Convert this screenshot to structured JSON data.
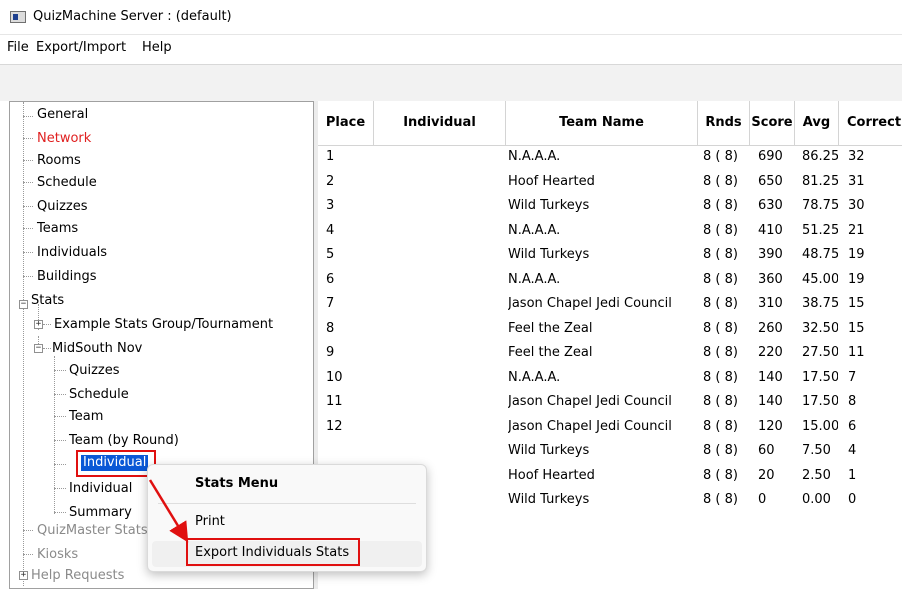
{
  "window": {
    "title": "QuizMachine Server : (default)"
  },
  "menubar": {
    "items": [
      "File",
      "Export/Import",
      "Help"
    ]
  },
  "tree": {
    "items": [
      {
        "label": "General",
        "color": "#000000"
      },
      {
        "label": "Network",
        "color": "#e02020"
      },
      {
        "label": "Rooms",
        "color": "#000000"
      },
      {
        "label": "Schedule",
        "color": "#000000"
      },
      {
        "label": "Quizzes",
        "color": "#000000"
      },
      {
        "label": "Teams",
        "color": "#000000"
      },
      {
        "label": "Individuals",
        "color": "#000000"
      },
      {
        "label": "Buildings",
        "color": "#000000"
      },
      {
        "label": "Stats",
        "color": "#000000"
      },
      {
        "label": "Example Stats Group/Tournament",
        "color": "#000000"
      },
      {
        "label": "MidSouth Nov",
        "color": "#000000"
      },
      {
        "label": "Quizzes",
        "color": "#000000"
      },
      {
        "label": "Schedule",
        "color": "#000000"
      },
      {
        "label": "Team",
        "color": "#000000"
      },
      {
        "label": "Team (by Round)",
        "color": "#000000"
      },
      {
        "label": "Individual",
        "color": "#ffffff"
      },
      {
        "label": "Individual",
        "color": "#000000"
      },
      {
        "label": "Summary",
        "color": "#000000"
      },
      {
        "label": "QuizMaster Stats",
        "color": "#8a8a8a"
      },
      {
        "label": "Kiosks",
        "color": "#8a8a8a"
      },
      {
        "label": "Help Requests",
        "color": "#8a8a8a"
      }
    ]
  },
  "table": {
    "columns": [
      "Place",
      "Individual",
      "Team Name",
      "Rnds",
      "Score",
      "Avg",
      "Correct"
    ],
    "rows": [
      [
        "1",
        "",
        "N.A.A.A.",
        "8 ( 8)",
        "690",
        "86.25",
        "32"
      ],
      [
        "2",
        "",
        "Hoof Hearted",
        "8 ( 8)",
        "650",
        "81.25",
        "31"
      ],
      [
        "3",
        "",
        "Wild Turkeys",
        "8 ( 8)",
        "630",
        "78.75",
        "30"
      ],
      [
        "4",
        "",
        "N.A.A.A.",
        "8 ( 8)",
        "410",
        "51.25",
        "21"
      ],
      [
        "5",
        "",
        "Wild Turkeys",
        "8 ( 8)",
        "390",
        "48.75",
        "19"
      ],
      [
        "6",
        "",
        "N.A.A.A.",
        "8 ( 8)",
        "360",
        "45.00",
        "19"
      ],
      [
        "7",
        "",
        "Jason Chapel Jedi Council",
        "8 ( 8)",
        "310",
        "38.75",
        "15"
      ],
      [
        "8",
        "",
        "Feel the Zeal",
        "8 ( 8)",
        "260",
        "32.50",
        "15"
      ],
      [
        "9",
        "",
        "Feel the Zeal",
        "8 ( 8)",
        "220",
        "27.50",
        "11"
      ],
      [
        "10",
        "",
        "N.A.A.A.",
        "8 ( 8)",
        "140",
        "17.50",
        "7"
      ],
      [
        "11",
        "",
        "Jason Chapel Jedi Council",
        "8 ( 8)",
        "140",
        "17.50",
        "8"
      ],
      [
        "12",
        "",
        "Jason Chapel Jedi Council",
        "8 ( 8)",
        "120",
        "15.00",
        "6"
      ],
      [
        "",
        "",
        "Wild Turkeys",
        "8 ( 8)",
        "60",
        "7.50",
        "4"
      ],
      [
        "",
        "",
        "Hoof Hearted",
        "8 ( 8)",
        "20",
        "2.50",
        "1"
      ],
      [
        "",
        "",
        "Wild Turkeys",
        "8 ( 8)",
        "0",
        "0.00",
        "0"
      ]
    ]
  },
  "context_menu": {
    "title": "Stats Menu",
    "items": [
      "Print",
      "Export Individuals Stats"
    ]
  },
  "colors": {
    "selection": "#0a58d6",
    "highlight_box": "#e01010",
    "annotation_arrow": "#e01010"
  }
}
